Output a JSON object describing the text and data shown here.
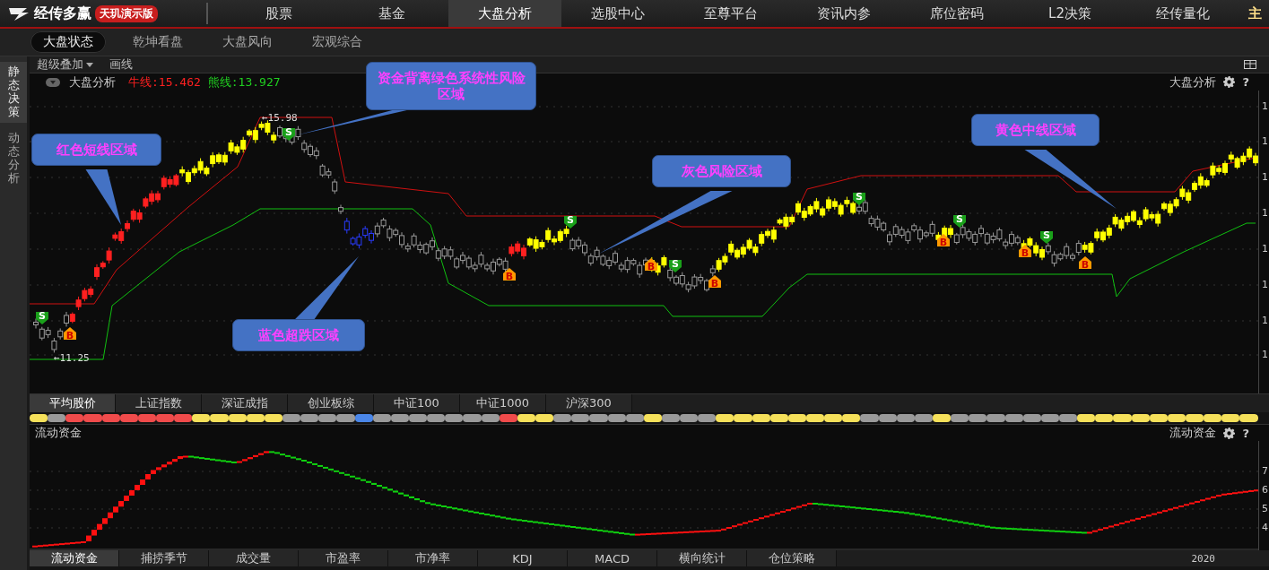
{
  "app": {
    "logo_text": "经传多赢",
    "edition_badge": "天玑演示版"
  },
  "nav": [
    {
      "label": "股票",
      "selected": false,
      "kind": "menu"
    },
    {
      "label": "基金",
      "selected": false,
      "kind": "menu"
    },
    {
      "label": "大盘分析",
      "selected": true,
      "kind": "menu"
    },
    {
      "label": "选股中心",
      "selected": false,
      "kind": "menu"
    },
    {
      "label": "至尊平台",
      "selected": false,
      "kind": "menu"
    },
    {
      "label": "资讯内参",
      "selected": false,
      "kind": "menu"
    },
    {
      "label": "席位密码",
      "selected": false,
      "kind": "menu"
    },
    {
      "label": "L2决策",
      "selected": false,
      "kind": "menu"
    },
    {
      "label": "经传量化",
      "selected": false,
      "kind": "menu"
    },
    {
      "label": "主",
      "selected": false,
      "kind": "featured"
    }
  ],
  "sub_tabs": [
    {
      "label": "大盘状态",
      "selected": true
    },
    {
      "label": "乾坤看盘",
      "selected": false
    },
    {
      "label": "大盘风向",
      "selected": false
    },
    {
      "label": "宏观综合",
      "selected": false
    }
  ],
  "side_tabs": [
    {
      "label": "静态决策",
      "selected": true
    },
    {
      "label": "动态分析",
      "selected": false
    }
  ],
  "toolbar": {
    "overlay_menu": "超级叠加",
    "draw_lines": "画线"
  },
  "chart_header": {
    "title": "大盘分析",
    "bull_line": "牛线:15.462",
    "bear_line": "熊线:13.927",
    "right_title": "大盘分析",
    "help_label": "?"
  },
  "callouts": [
    {
      "text": "资金背离绿色系统性风险区域"
    },
    {
      "text": "红色短线区域"
    },
    {
      "text": "灰色风险区域"
    },
    {
      "text": "黄色中线区域"
    },
    {
      "text": "蓝色超跌区域"
    }
  ],
  "price_marks": [
    "←15.98",
    "←11.25"
  ],
  "signals": [
    {
      "label": "S",
      "kind": "sell"
    },
    {
      "label": "B",
      "kind": "buy"
    },
    {
      "label": "S",
      "kind": "sell"
    },
    {
      "label": "B",
      "kind": "buy"
    },
    {
      "label": "S",
      "kind": "sell"
    },
    {
      "label": "B",
      "kind": "buy"
    },
    {
      "label": "S",
      "kind": "sell"
    },
    {
      "label": "B",
      "kind": "buy"
    },
    {
      "label": "S",
      "kind": "sell"
    },
    {
      "label": "B",
      "kind": "buy"
    },
    {
      "label": "S",
      "kind": "sell"
    },
    {
      "label": "B",
      "kind": "buy"
    },
    {
      "label": "S",
      "kind": "sell"
    },
    {
      "label": "B",
      "kind": "buy"
    }
  ],
  "y_axis_labels": [
    "1",
    "1",
    "1",
    "1",
    "1",
    "1",
    "1",
    "1"
  ],
  "index_tabs": [
    {
      "label": "平均股价",
      "selected": true
    },
    {
      "label": "上证指数",
      "selected": false
    },
    {
      "label": "深证成指",
      "selected": false
    },
    {
      "label": "创业板综",
      "selected": false
    },
    {
      "label": "中证100",
      "selected": false
    },
    {
      "label": "中证1000",
      "selected": false
    },
    {
      "label": "沪深300",
      "selected": false
    }
  ],
  "state_strip": [
    {
      "color": "#f5e05a"
    },
    {
      "color": "#9a9a9a"
    },
    {
      "color": "#f04b4b"
    },
    {
      "color": "#f04b4b"
    },
    {
      "color": "#f04b4b"
    },
    {
      "color": "#f04b4b"
    },
    {
      "color": "#f04b4b"
    },
    {
      "color": "#f04b4b"
    },
    {
      "color": "#f04b4b"
    },
    {
      "color": "#f5e05a"
    },
    {
      "color": "#f5e05a"
    },
    {
      "color": "#f5e05a"
    },
    {
      "color": "#f5e05a"
    },
    {
      "color": "#f5e05a"
    },
    {
      "color": "#9a9a9a"
    },
    {
      "color": "#9a9a9a"
    },
    {
      "color": "#9a9a9a"
    },
    {
      "color": "#9a9a9a"
    },
    {
      "color": "#4a86e8"
    },
    {
      "color": "#9a9a9a"
    },
    {
      "color": "#9a9a9a"
    },
    {
      "color": "#9a9a9a"
    },
    {
      "color": "#9a9a9a"
    },
    {
      "color": "#9a9a9a"
    },
    {
      "color": "#9a9a9a"
    },
    {
      "color": "#9a9a9a"
    },
    {
      "color": "#f04b4b"
    },
    {
      "color": "#f5e05a"
    },
    {
      "color": "#f5e05a"
    },
    {
      "color": "#9a9a9a"
    },
    {
      "color": "#9a9a9a"
    },
    {
      "color": "#9a9a9a"
    },
    {
      "color": "#9a9a9a"
    },
    {
      "color": "#9a9a9a"
    },
    {
      "color": "#f5e05a"
    },
    {
      "color": "#9a9a9a"
    },
    {
      "color": "#9a9a9a"
    },
    {
      "color": "#9a9a9a"
    },
    {
      "color": "#f5e05a"
    },
    {
      "color": "#f5e05a"
    },
    {
      "color": "#f5e05a"
    },
    {
      "color": "#f5e05a"
    },
    {
      "color": "#f5e05a"
    },
    {
      "color": "#f5e05a"
    },
    {
      "color": "#f5e05a"
    },
    {
      "color": "#f5e05a"
    },
    {
      "color": "#9a9a9a"
    },
    {
      "color": "#9a9a9a"
    },
    {
      "color": "#9a9a9a"
    },
    {
      "color": "#9a9a9a"
    },
    {
      "color": "#f5e05a"
    },
    {
      "color": "#9a9a9a"
    },
    {
      "color": "#9a9a9a"
    },
    {
      "color": "#9a9a9a"
    },
    {
      "color": "#9a9a9a"
    },
    {
      "color": "#9a9a9a"
    },
    {
      "color": "#9a9a9a"
    },
    {
      "color": "#9a9a9a"
    },
    {
      "color": "#f5e05a"
    },
    {
      "color": "#f5e05a"
    },
    {
      "color": "#f5e05a"
    },
    {
      "color": "#f5e05a"
    },
    {
      "color": "#f5e05a"
    },
    {
      "color": "#f5e05a"
    },
    {
      "color": "#f5e05a"
    },
    {
      "color": "#f5e05a"
    },
    {
      "color": "#f5e05a"
    },
    {
      "color": "#f5e05a"
    }
  ],
  "flow_panel": {
    "title": "流动资金",
    "right_title": "流动资金",
    "help_label": "?",
    "y_axis_labels": [
      "7",
      "6",
      "5",
      "4"
    ],
    "x_axis_label": "2020"
  },
  "bottom_tabs": [
    {
      "label": "流动资金",
      "selected": true
    },
    {
      "label": "捕捞季节",
      "selected": false
    },
    {
      "label": "成交量",
      "selected": false
    },
    {
      "label": "市盈率",
      "selected": false
    },
    {
      "label": "市净率",
      "selected": false
    },
    {
      "label": "KDJ",
      "selected": false
    },
    {
      "label": "MACD",
      "selected": false
    },
    {
      "label": "横向统计",
      "selected": false
    },
    {
      "label": "仓位策略",
      "selected": false
    }
  ]
}
